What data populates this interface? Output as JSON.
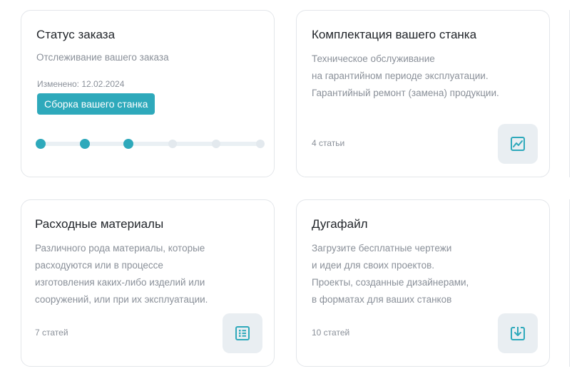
{
  "status_card": {
    "title": "Статус заказа",
    "subtitle": "Отслеживание вашего заказа",
    "changed": "Изменено: 12.02.2024",
    "badge": "Сборка вашего станка",
    "progress": {
      "total_steps": 6,
      "completed_steps": 3
    }
  },
  "kit_card": {
    "title": "Комплектация вашего станка",
    "lines": [
      "Техническое обслуживание",
      "на гарантийном периоде эксплуатации.",
      "Гарантийный ремонт (замена) продукции."
    ],
    "count": "4 статьи",
    "icon": "chart-icon"
  },
  "consumables_card": {
    "title": "Расходные материалы",
    "lines": [
      "Различного рода материалы, которые",
      "расходуются или в процессе",
      "изготовления каких-либо изделий или",
      "сооружений, или при их эксплуатации."
    ],
    "count": "7 статей",
    "icon": "list-icon"
  },
  "dugafile_card": {
    "title": "Дугафайл",
    "lines": [
      "Загрузите бесплатные чертежи",
      "и идеи для своих проектов.",
      "Проекты, созданные дизайнерами,",
      "в форматах для ваших станков"
    ],
    "count": "10 статей",
    "icon": "download-icon"
  },
  "colors": {
    "accent": "#2ea9bb",
    "muted_text": "#8a9099",
    "icon_bg": "#e9eef2",
    "border": "#e3e6ea"
  }
}
